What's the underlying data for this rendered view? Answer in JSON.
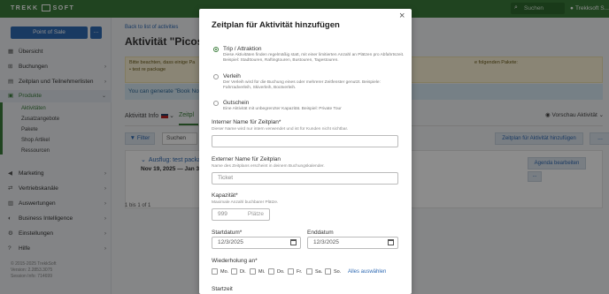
{
  "topbar": {
    "logo_left": "TREKK",
    "logo_right": "SOFT",
    "search_placeholder": "Suchen",
    "user": "Trekksoft S..."
  },
  "sidebar": {
    "pos_button": "Point of Sale",
    "pos_more": "...",
    "items": [
      {
        "label": "Übersicht",
        "icon": "home-icon",
        "glyph": "▦"
      },
      {
        "label": "Buchungen",
        "icon": "cart-icon",
        "glyph": "🛒"
      },
      {
        "label": "Zeitplan und Teilnehmerlisten",
        "icon": "calendar-icon",
        "glyph": "▤"
      },
      {
        "label": "Produkte",
        "icon": "tag-icon",
        "glyph": "▤"
      },
      {
        "label": "Marketing",
        "icon": "megaphone-icon",
        "glyph": "📢"
      },
      {
        "label": "Vertriebskanäle",
        "icon": "share-icon",
        "glyph": "⇄"
      },
      {
        "label": "Auswertungen",
        "icon": "report-icon",
        "glyph": "▥"
      },
      {
        "label": "Business Intelligence",
        "icon": "bi-icon",
        "glyph": "◐"
      },
      {
        "label": "Einstellungen",
        "icon": "gear-icon",
        "glyph": "⚙"
      },
      {
        "label": "Hilfe",
        "icon": "help-icon",
        "glyph": "?"
      }
    ],
    "subitems": [
      "Aktivitäten",
      "Zusatzangebote",
      "Pakete",
      "Shop Artikel",
      "Ressourcen"
    ],
    "footer": [
      "© 2015-2025 TrekkSoft",
      "Version: 2.2853.3075",
      "Session Info: 714699"
    ]
  },
  "main": {
    "back_link": "Back to list of activities",
    "title": "Aktivität \"Picos",
    "warning_left": [
      "Bitte beachten, dass einige Pa",
      "• test re package"
    ],
    "warning_right": "e folgenden Pakete:",
    "info": "You can generate \"Book Now\"",
    "tab_info": "Aktivität Info",
    "tab_schedule": "Zeitpl",
    "preview": "Vorschau Aktivität",
    "filter_label": "Filter",
    "search_label": "Suchen",
    "add_schedule": "Zeitplan für Aktivität hinzufügen",
    "more": "...",
    "schedule_title": "Ausflug: test package",
    "schedule_dates": "Nov 19, 2025 — Jan 31, 2",
    "agenda_button": "Agenda bearbeiten",
    "card_more": "...",
    "pager": "1 bis 1 of 1"
  },
  "modal": {
    "title": "Zeitplan für Aktivität hinzufügen",
    "close": "×",
    "types": [
      {
        "label": "Trip / Attraktion",
        "desc": "Diese Aktivitäten finden regelmäßig statt, mit einer limitierten Anzahl an Plätzen pro Abfahrtszeit. Beispiel: Stadttouren, Raftingtouren, Bustouren, Tagestouren.",
        "selected": true
      },
      {
        "label": "Verleih",
        "desc": "Der Verleih wird für die Buchung eines oder mehrerer Zeitfenster genutzt. Beispiele: Fahrradverleih, Skiverleih, Bootverleih.",
        "selected": false
      },
      {
        "label": "Gutschein",
        "desc": "Eine Aktivität mit unbegrenzter Kapazität. Beispiel: Private Tour",
        "selected": false
      }
    ],
    "internal_label": "Interner Name für Zeitplan*",
    "internal_hint": "Dieser Name wird nur intern verwendet und ist für Kunden nicht sichtbar.",
    "internal_value": "",
    "external_label": "Externer Name für Zeitplan",
    "external_hint": "Name des Zeitplans erscheint in deinem Buchungskalender.",
    "external_placeholder": "Ticket",
    "capacity_label": "Kapazität*",
    "capacity_hint": "Maximale Anzahl buchbarer Plätze.",
    "capacity_placeholder": "999",
    "capacity_suffix": "Plätze",
    "start_label": "Startdatum*",
    "start_value": "12/3/2025",
    "end_label": "Enddatum",
    "end_value": "12/3/2025",
    "repeat_label": "Wiederholung an*",
    "days": [
      "Mo.",
      "Di.",
      "Mi.",
      "Do.",
      "Fr.",
      "Sa.",
      "So."
    ],
    "select_all": "Alles auswählen",
    "start_time_label": "Startzeit"
  }
}
